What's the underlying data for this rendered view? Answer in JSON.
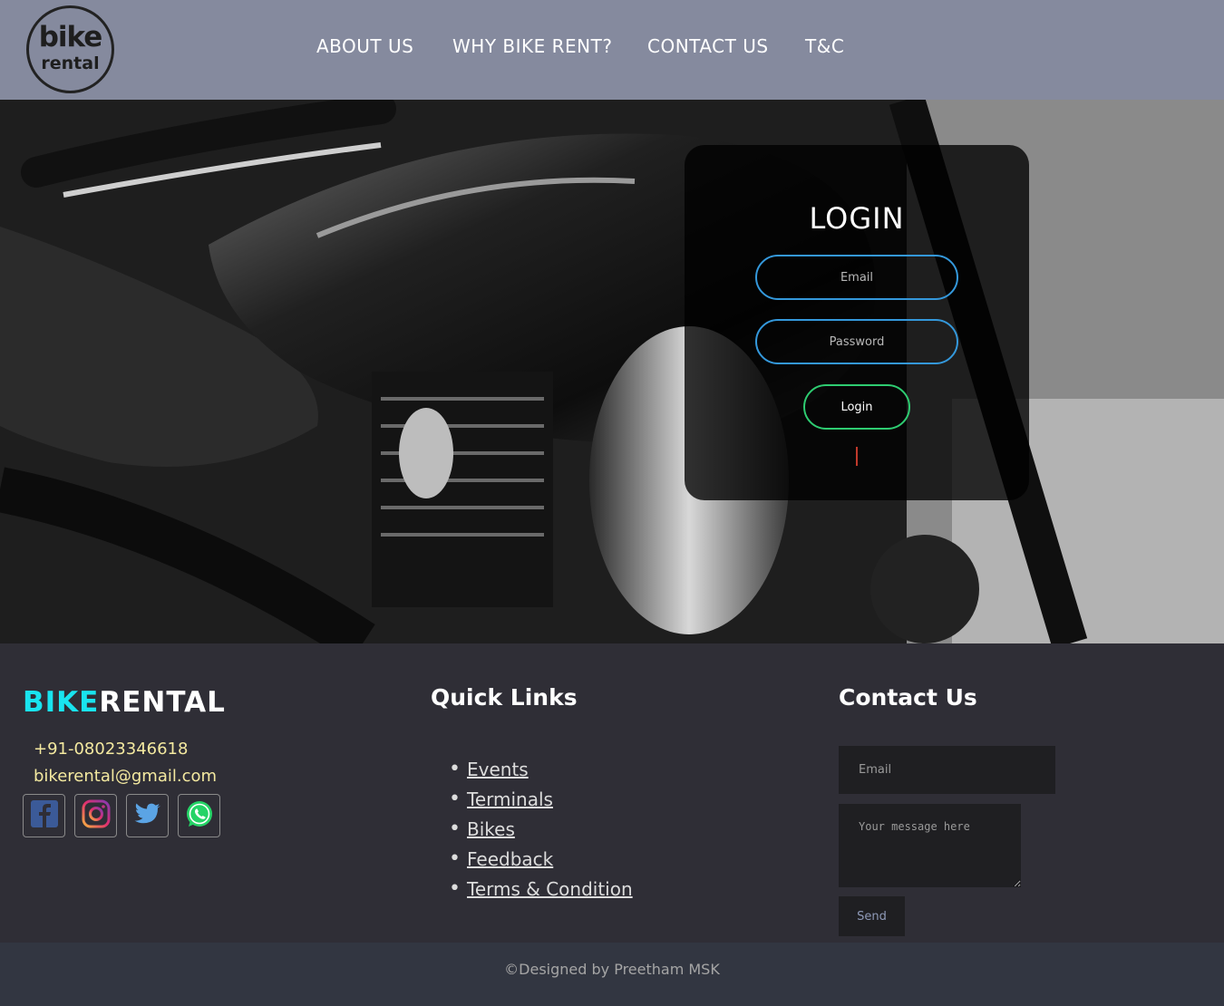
{
  "logo": {
    "line1": "bike",
    "line2": "rental"
  },
  "nav": {
    "about": "ABOUT US",
    "why": "WHY BIKE RENT?",
    "contact": "CONTACT US",
    "tc": "T&C"
  },
  "hero": {
    "image": "motorcycle-photo"
  },
  "login": {
    "title": "LOGIN",
    "email_placeholder": "Email",
    "password_placeholder": "Password",
    "button": "Login"
  },
  "footer": {
    "brand_part1": "BIKE",
    "brand_part2": "RENTAL",
    "phone": "+91-08023346618",
    "email": "bikerental@gmail.com",
    "social": [
      "facebook-icon",
      "instagram-icon",
      "twitter-icon",
      "whatsapp-icon"
    ],
    "quick_links_title": "Quick Links",
    "quick_links": [
      "Events",
      "Terminals",
      "Bikes",
      "Feedback",
      "Terms & Condition"
    ],
    "contact_title": "Contact Us",
    "form_email_placeholder": "Email",
    "form_message_placeholder": "Your message here",
    "send": "Send",
    "copyright": "©Designed by Preetham MSK"
  },
  "colors": {
    "header": "#858a9e",
    "footer": "#2f2e36",
    "brand_accent": "#19e4ef",
    "input_border": "#3498db",
    "button_border": "#2ecc71"
  }
}
